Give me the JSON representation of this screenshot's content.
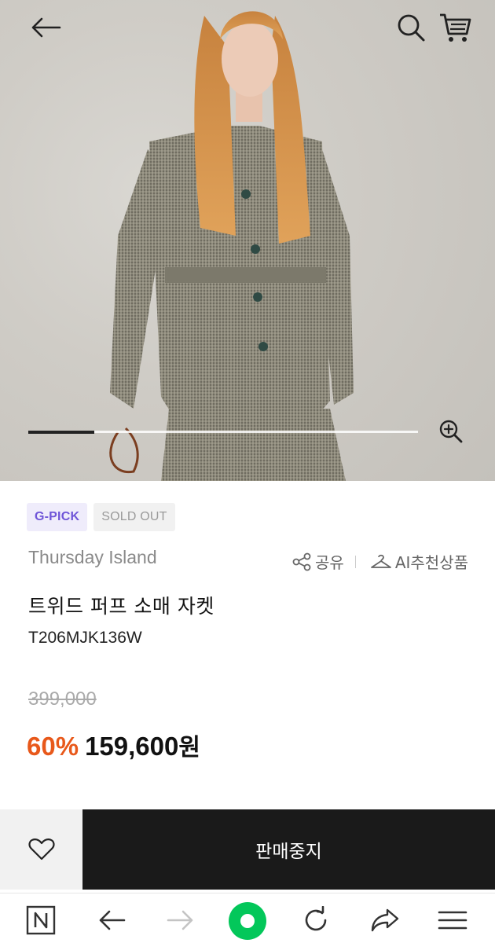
{
  "header": {
    "back_icon": "arrow-left-icon",
    "search_icon": "search-icon",
    "cart_icon": "cart-icon"
  },
  "gallery": {
    "progress": 0.17,
    "zoom_icon": "zoom-in-icon"
  },
  "badges": [
    "G-PICK",
    "SOLD OUT"
  ],
  "product": {
    "brand": "Thursday Island",
    "share_label": "공유",
    "ai_label": "AI추천상품",
    "title": "트위드 퍼프 소매 자켓",
    "code": "T206MJK136W",
    "original_price": "399,000",
    "discount": "60%",
    "sale_price": "159,600",
    "currency": "원"
  },
  "purchase": {
    "wish_icon": "heart-icon",
    "status_label": "판매중지"
  },
  "browser_nav": {
    "icons": [
      "naver-n-icon",
      "back-arrow-icon",
      "forward-arrow-icon",
      "green-dot-home-icon",
      "refresh-icon",
      "share-arrow-icon",
      "menu-icon"
    ]
  },
  "colors": {
    "accent_purple": "#6f55d8",
    "discount_orange": "#e8581a",
    "buy_bar_dark": "#1a1a1a",
    "naver_green": "#03c75a"
  }
}
